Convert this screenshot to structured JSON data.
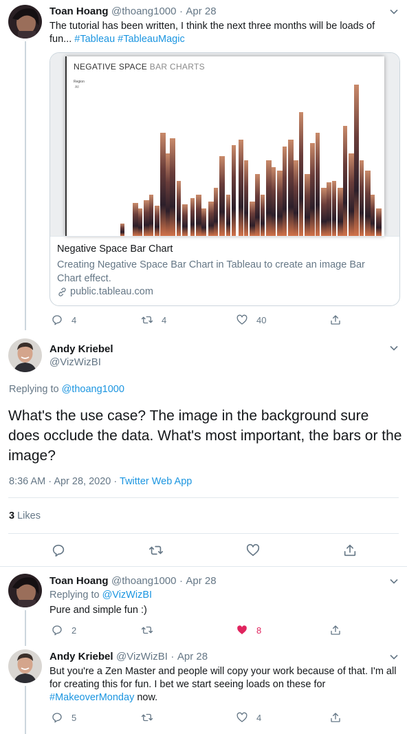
{
  "tweets": [
    {
      "name": "Toan Hoang",
      "handle": "@thoang1000",
      "sep": "·",
      "date": "Apr 28",
      "text_plain": "The tutorial has been written, I think the next three months will be loads of fun...",
      "hashtag1": "#Tableau",
      "hashtag2": "#TableauMagic",
      "replies": "4",
      "retweets": "4",
      "likes": "40"
    },
    {
      "name": "Toan Hoang",
      "handle": "@thoang1000",
      "sep": "·",
      "date": "Apr 28",
      "replying_prefix": "Replying to",
      "replying_to": "@VizWizBI",
      "text": "Pure and simple fun :)",
      "replies": "2",
      "retweets": "",
      "likes": "8"
    },
    {
      "name": "Andy Kriebel",
      "handle": "@VizWizBI",
      "sep": "·",
      "date": "Apr 28",
      "text_plain": "But you're a Zen Master and people will copy your work because of that. I'm all for creating this for fun. I bet we start seeing loads on these for",
      "hashtag": "#MakeoverMonday",
      "text_end": "now.",
      "replies": "5",
      "retweets": "",
      "likes": "4"
    }
  ],
  "card": {
    "chart_title_bold": "NEGATIVE SPACE",
    "chart_title_light": "BAR CHARTS",
    "filter_label": "Region",
    "filter_value": "All",
    "title": "Negative Space Bar Chart",
    "description": "Creating Negative Space Bar Chart in Tableau to create an image Bar Chart effect.",
    "domain": "public.tableau.com"
  },
  "main": {
    "name": "Andy Kriebel",
    "handle": "@VizWizBI",
    "replying_prefix": "Replying to",
    "replying_to": "@thoang1000",
    "text": "What's the use case? The image in the background sure does occlude the data. What's most important, the bars or the image?",
    "time": "8:36 AM",
    "sep": "·",
    "date": "Apr 28, 2020",
    "source": "Twitter Web App",
    "likes_count": "3",
    "likes_label": "Likes"
  },
  "colors": {
    "link": "#1b95e0",
    "like_active": "#e0245e",
    "muted": "#657786"
  }
}
